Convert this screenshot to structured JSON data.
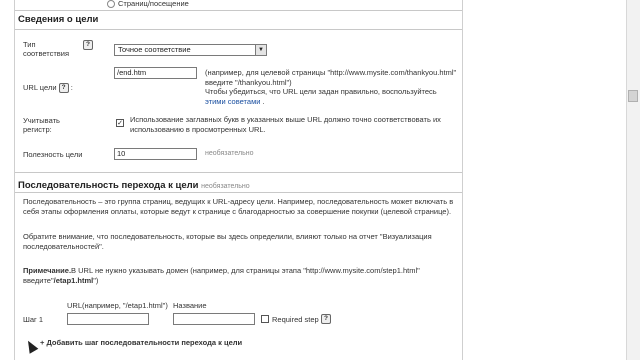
{
  "top": {
    "radio_label": "Страниц/посещение"
  },
  "goal": {
    "section_title": "Сведения о цели",
    "match_type_label_line1": "Тип",
    "match_type_label_line2": "соответствия",
    "help_icon": "?",
    "match_type_value": "Точное соответствие",
    "url_label": "URL цели",
    "url_value": "/end.htm",
    "url_hint_line1": "(например, для целевой страницы \"http://www.mysite.com/thankyou.html\"",
    "url_hint_line2": "введите \"/thankyou.html\")",
    "url_hint_line3": "Чтобы убедиться, что URL цели задан правильно, воспользуйтесь",
    "url_hint_link": "этими советами",
    "url_hint_tail": ".",
    "case_label_line1": "Учитывать",
    "case_label_line2": "регистр:",
    "case_text_line1": "Использование заглавных букв в указанных выше URL должно точно соответствовать их",
    "case_text_line2": "использованию в просмотренных URL.",
    "value_label": "Полезность цели",
    "value_value": "10",
    "value_optional": "необязательно"
  },
  "funnel": {
    "section_title": "Последовательность перехода к цели",
    "optional": "необязательно",
    "para1_line1": "Последовательность – это группа страниц, ведущих к URL-адресу цели. Например, последовательность может включать в",
    "para1_line2": "себя этапы оформления оплаты, которые ведут к странице с благодарностью за совершение покупки (целевой странице).",
    "para2_line1": "Обратите внимание, что последовательность, которые вы здесь определили, влияют только на отчет \"Визуализация",
    "para2_line2": "последовательностей\".",
    "note_bold": "Примечание.",
    "note_line1": "В URL не нужно указывать домен (например, для страницы этапа \"http://www.mysite.com/step1.html\"",
    "note_line2_prefix": "введите\"",
    "note_line2_bold": "/etap1.html",
    "note_line2_suffix": "\")",
    "col_url": "URL(например, \"/etap1.html\")",
    "col_name": "Название",
    "step_label": "Шаг 1",
    "step_url_value": "",
    "step_name_value": "",
    "required_label": "Required step",
    "add_step": "+ Добавить шаг последовательности перехода к цели"
  }
}
